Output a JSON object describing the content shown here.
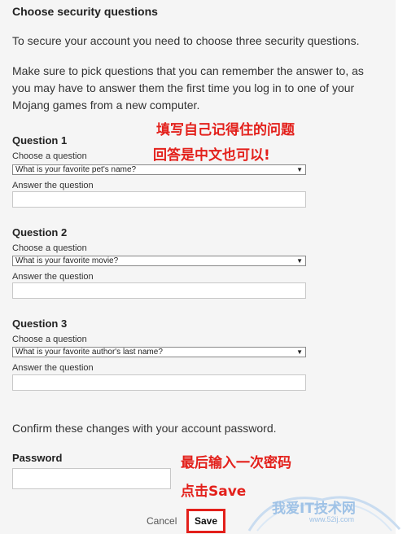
{
  "form": {
    "heading": "Choose security questions",
    "intro": "To secure your account you need to choose three security questions.",
    "note": "Make sure to pick questions that you can remember the answer to, as you may have to answer them the first time you log in to one of your Mojang games from a new computer.",
    "choose_label": "Choose a question",
    "answer_label": "Answer the question",
    "questions": [
      {
        "title": "Question 1",
        "selected": "What is your favorite pet's name?"
      },
      {
        "title": "Question 2",
        "selected": "What is your favorite movie?"
      },
      {
        "title": "Question 3",
        "selected": "What is your favorite author's last name?"
      }
    ],
    "confirm_text": "Confirm these changes with your account password.",
    "password_label": "Password",
    "cancel_label": "Cancel",
    "save_label": "Save"
  },
  "annotations": {
    "line1": "填写自己记得住的问题",
    "line2": "回答是中文也可以!",
    "line3": "最后输入一次密码",
    "line4": "点击Save"
  },
  "watermark": {
    "text": "我爱IT技术网",
    "url": "www.52ij.com"
  },
  "colors": {
    "annotation": "#e3201b",
    "panel_bg": "#f5f5f5",
    "watermark": "#9fc2e6"
  }
}
